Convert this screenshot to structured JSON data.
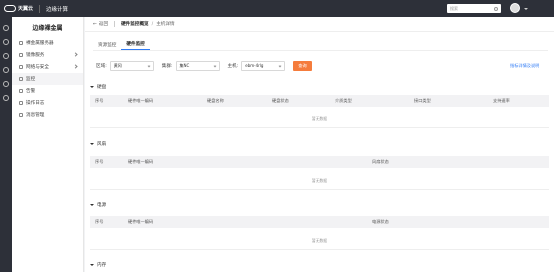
{
  "topbar": {
    "brand": "天翼云",
    "product": "边缘计算",
    "search_placeholder": "搜索"
  },
  "sidebar": {
    "title": "边缘裸金属",
    "items": [
      {
        "label": "裸金属服务器",
        "icon": "server-icon",
        "has_caret": false
      },
      {
        "label": "镜像服务",
        "icon": "image-icon",
        "has_caret": true
      },
      {
        "label": "网络与安全",
        "icon": "network-icon",
        "has_caret": true
      },
      {
        "label": "监控",
        "icon": "monitor-icon",
        "has_caret": false
      },
      {
        "label": "告警",
        "icon": "alarm-icon",
        "has_caret": false
      },
      {
        "label": "操作日志",
        "icon": "log-icon",
        "has_caret": false
      },
      {
        "label": "消息管理",
        "icon": "message-icon",
        "has_caret": false
      }
    ]
  },
  "breadcrumb": {
    "back": "返回",
    "current": "硬件监控概览",
    "separator": "/",
    "sub": "主机详情"
  },
  "tabs": [
    {
      "label": "资源监控",
      "active": false
    },
    {
      "label": "硬件监控",
      "active": true
    }
  ],
  "filters": {
    "region_label": "区域:",
    "region_value": "黄冈",
    "cluster_label": "集群:",
    "cluster_value": "集NC",
    "host_label": "主机:",
    "host_value": "ebm-4rlg",
    "search_button": "查询",
    "desc_link": "指标详情及说明"
  },
  "sections": [
    {
      "title": "硬盘",
      "columns": [
        "序号",
        "硬件唯一编码",
        "硬盘名称",
        "硬盘状态",
        "介质类型",
        "接口类型",
        "支持速率"
      ],
      "empty_text": "暂无数据"
    },
    {
      "title": "风扇",
      "columns": [
        "序号",
        "硬件唯一编码",
        "风扇状态"
      ],
      "empty_text": "暂无数据"
    },
    {
      "title": "电源",
      "columns": [
        "序号",
        "硬件唯一编码",
        "电源状态"
      ],
      "empty_text": "暂无数据"
    },
    {
      "title": "内存",
      "columns": [],
      "empty_text": ""
    }
  ],
  "colors": {
    "topbar": "#2d3039",
    "accent": "#2f7bf5",
    "search_button": "#f57c3c"
  }
}
